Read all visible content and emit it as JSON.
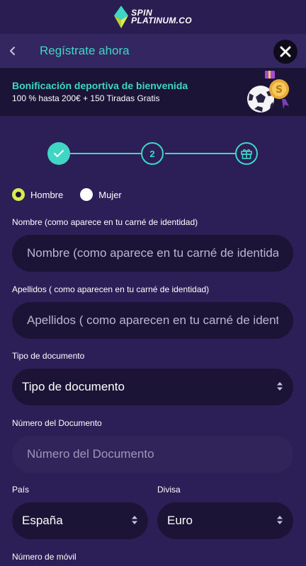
{
  "logo": {
    "line1": "SPIN",
    "line2": "PLATINUM.CO"
  },
  "header": {
    "title": "Regístrate ahora"
  },
  "bonus": {
    "title": "Bonificación deportiva de bienvenida",
    "subtitle": "100 % hasta 200€ + 150 Tiradas Gratis"
  },
  "stepper": {
    "current_step": "2"
  },
  "gender": {
    "options": [
      {
        "label": "Hombre",
        "checked": true
      },
      {
        "label": "Mujer",
        "checked": false
      }
    ]
  },
  "form": {
    "first_name": {
      "label": "Nombre (como aparece en tu carné de identidad)",
      "placeholder": "Nombre (como aparece en tu carné de identidad)"
    },
    "last_name": {
      "label": "Apellidos ( como aparecen en tu carné de identidad)",
      "placeholder": "Apellidos ( como aparecen en tu carné de identidad)"
    },
    "document_type": {
      "label": "Tipo de documento",
      "value": "Tipo de documento"
    },
    "document_number": {
      "label": "Número del Documento",
      "placeholder": "Número del Documento"
    },
    "country": {
      "label": "País",
      "value": "España"
    },
    "currency": {
      "label": "Divisa",
      "value": "Euro"
    },
    "mobile": {
      "label": "Número de móvil"
    }
  },
  "colors": {
    "accent": "#3fd7c4",
    "background": "#2c1f57",
    "field_bg": "#1b1436",
    "radio_checked": "#d8ec4d"
  }
}
